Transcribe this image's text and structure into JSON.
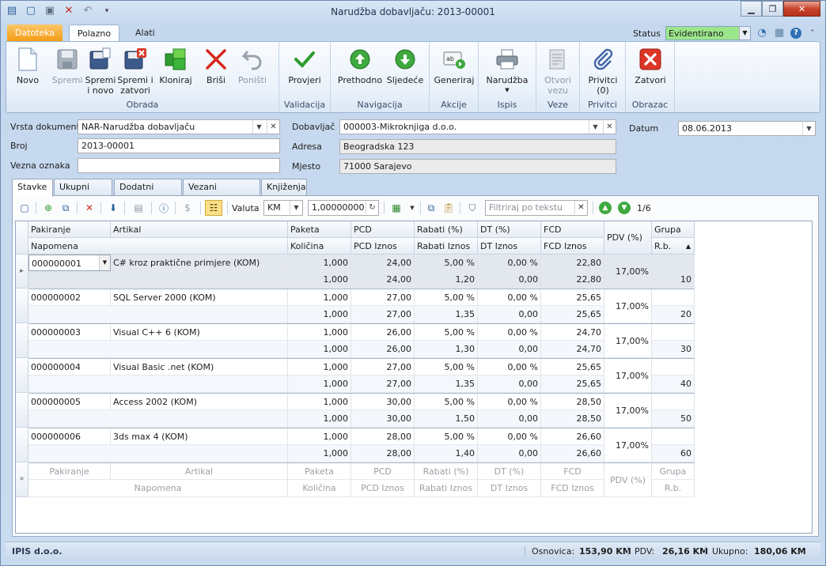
{
  "window": {
    "title": "Narudžba dobavljaču: 2013-00001"
  },
  "ribbon_tabs": {
    "file": "Datoteka",
    "home": "Polazno",
    "tools": "Alati"
  },
  "status": {
    "label": "Status",
    "value": "Evidentirano"
  },
  "ribbon": {
    "groups": {
      "obrada": "Obrada",
      "validacija": "Validacija",
      "navigacija": "Navigacija",
      "akcije": "Akcije",
      "ispis": "Ispis",
      "veze": "Veze",
      "privitci": "Privitci",
      "obrazac": "Obrazac"
    },
    "buttons": {
      "novo": "Novo",
      "spremi": "Spremi",
      "spremi_novo_1": "Spremi",
      "spremi_novo_2": "i novo",
      "spremi_zatvori_1": "Spremi i",
      "spremi_zatvori_2": "zatvori",
      "kloniraj": "Kloniraj",
      "brisi": "Briši",
      "ponisti": "Poništi",
      "provjeri": "Provjeri",
      "prethodno": "Prethodno",
      "sljedece": "Sljedeće",
      "generiraj": "Generiraj",
      "narudzba": "Narudžba",
      "otvori_1": "Otvori",
      "otvori_2": "vezu",
      "privitci_1": "Privitci",
      "privitci_2": "(0)",
      "zatvori": "Zatvori"
    }
  },
  "form": {
    "vrsta_label": "Vrsta dokumenta",
    "vrsta_value": "NAR-Narudžba dobavljaču",
    "broj_label": "Broj",
    "broj_value": "2013-00001",
    "vezna_label": "Vezna oznaka",
    "vezna_value": "",
    "dobavljac_label": "Dobavljač",
    "dobavljac_value": "000003-Mikroknjiga d.o.o.",
    "adresa_label": "Adresa",
    "adresa_value": "Beogradska 123",
    "mjesto_label": "Mjesto",
    "mjesto_value": "71000 Sarajevo",
    "datum_label": "Datum",
    "datum_value": "08.06.2013"
  },
  "tabs": [
    "Stavke",
    "Ukupni iznosi",
    "Dodatni podaci",
    "Vezani dokumenti",
    "Knjiženja"
  ],
  "toolbar": {
    "valuta_label": "Valuta",
    "valuta_value": "KM",
    "tecaj": "1,00000000",
    "filter_placeholder": "Filtriraj po tekstu",
    "page": "1/6"
  },
  "grid": {
    "headers_top": [
      "Pakiranje",
      "Artikal",
      "Paketa",
      "PCD",
      "Rabati (%)",
      "DT (%)",
      "FCD",
      "PDV (%)",
      "Grupa"
    ],
    "headers_bottom": [
      "Napomena",
      "Količina",
      "PCD Iznos",
      "Rabati Iznos",
      "DT Iznos",
      "FCD Iznos",
      "R.b."
    ],
    "rows": [
      {
        "pak": "000000001",
        "art": "C# kroz praktične primjere (KOM)",
        "paketa": "1,000",
        "pcd": "24,00",
        "rab": "5,00 %",
        "dt": "0,00 %",
        "fcd": "22,80",
        "kol": "1,000",
        "pcdi": "24,00",
        "rabi": "1,20",
        "dti": "0,00",
        "fcdi": "22,80",
        "pdv": "17,00%",
        "rb": "10"
      },
      {
        "pak": "000000002",
        "art": "SQL Server 2000 (KOM)",
        "paketa": "1,000",
        "pcd": "27,00",
        "rab": "5,00 %",
        "dt": "0,00 %",
        "fcd": "25,65",
        "kol": "1,000",
        "pcdi": "27,00",
        "rabi": "1,35",
        "dti": "0,00",
        "fcdi": "25,65",
        "pdv": "17,00%",
        "rb": "20"
      },
      {
        "pak": "000000003",
        "art": "Visual C++ 6 (KOM)",
        "paketa": "1,000",
        "pcd": "26,00",
        "rab": "5,00 %",
        "dt": "0,00 %",
        "fcd": "24,70",
        "kol": "1,000",
        "pcdi": "26,00",
        "rabi": "1,30",
        "dti": "0,00",
        "fcdi": "24,70",
        "pdv": "17,00%",
        "rb": "30"
      },
      {
        "pak": "000000004",
        "art": "Visual Basic .net (KOM)",
        "paketa": "1,000",
        "pcd": "27,00",
        "rab": "5,00 %",
        "dt": "0,00 %",
        "fcd": "25,65",
        "kol": "1,000",
        "pcdi": "27,00",
        "rabi": "1,35",
        "dti": "0,00",
        "fcdi": "25,65",
        "pdv": "17,00%",
        "rb": "40"
      },
      {
        "pak": "000000005",
        "art": "Access 2002 (KOM)",
        "paketa": "1,000",
        "pcd": "30,00",
        "rab": "5,00 %",
        "dt": "0,00 %",
        "fcd": "28,50",
        "kol": "1,000",
        "pcdi": "30,00",
        "rabi": "1,50",
        "dti": "0,00",
        "fcdi": "28,50",
        "pdv": "17,00%",
        "rb": "50"
      },
      {
        "pak": "000000006",
        "art": "3ds max 4 (KOM)",
        "paketa": "1,000",
        "pcd": "28,00",
        "rab": "5,00 %",
        "dt": "0,00 %",
        "fcd": "26,60",
        "kol": "1,000",
        "pcdi": "28,00",
        "rabi": "1,40",
        "dti": "0,00",
        "fcdi": "26,60",
        "pdv": "17,00%",
        "rb": "60"
      }
    ],
    "new_row_top": [
      "Pakiranje",
      "Artikal",
      "Paketa",
      "PCD",
      "Rabati (%)",
      "DT (%)",
      "FCD",
      "PDV (%)",
      "Grupa"
    ],
    "new_row_bottom": [
      "Napomena",
      "Količina",
      "PCD Iznos",
      "Rabati Iznos",
      "DT Iznos",
      "FCD Iznos",
      "R.b."
    ]
  },
  "statusbar": {
    "company": "IPIS d.o.o.",
    "osnovica_label": "Osnovica:",
    "osnovica": "153,90 KM",
    "pdv_label": "PDV:",
    "pdv": "26,16 KM",
    "ukupno_label": "Ukupno:",
    "ukupno": "180,06 KM"
  },
  "colors": {
    "accent": "#2f6fb4",
    "status_green": "#9be58a",
    "file_tab": "#f39b12"
  }
}
